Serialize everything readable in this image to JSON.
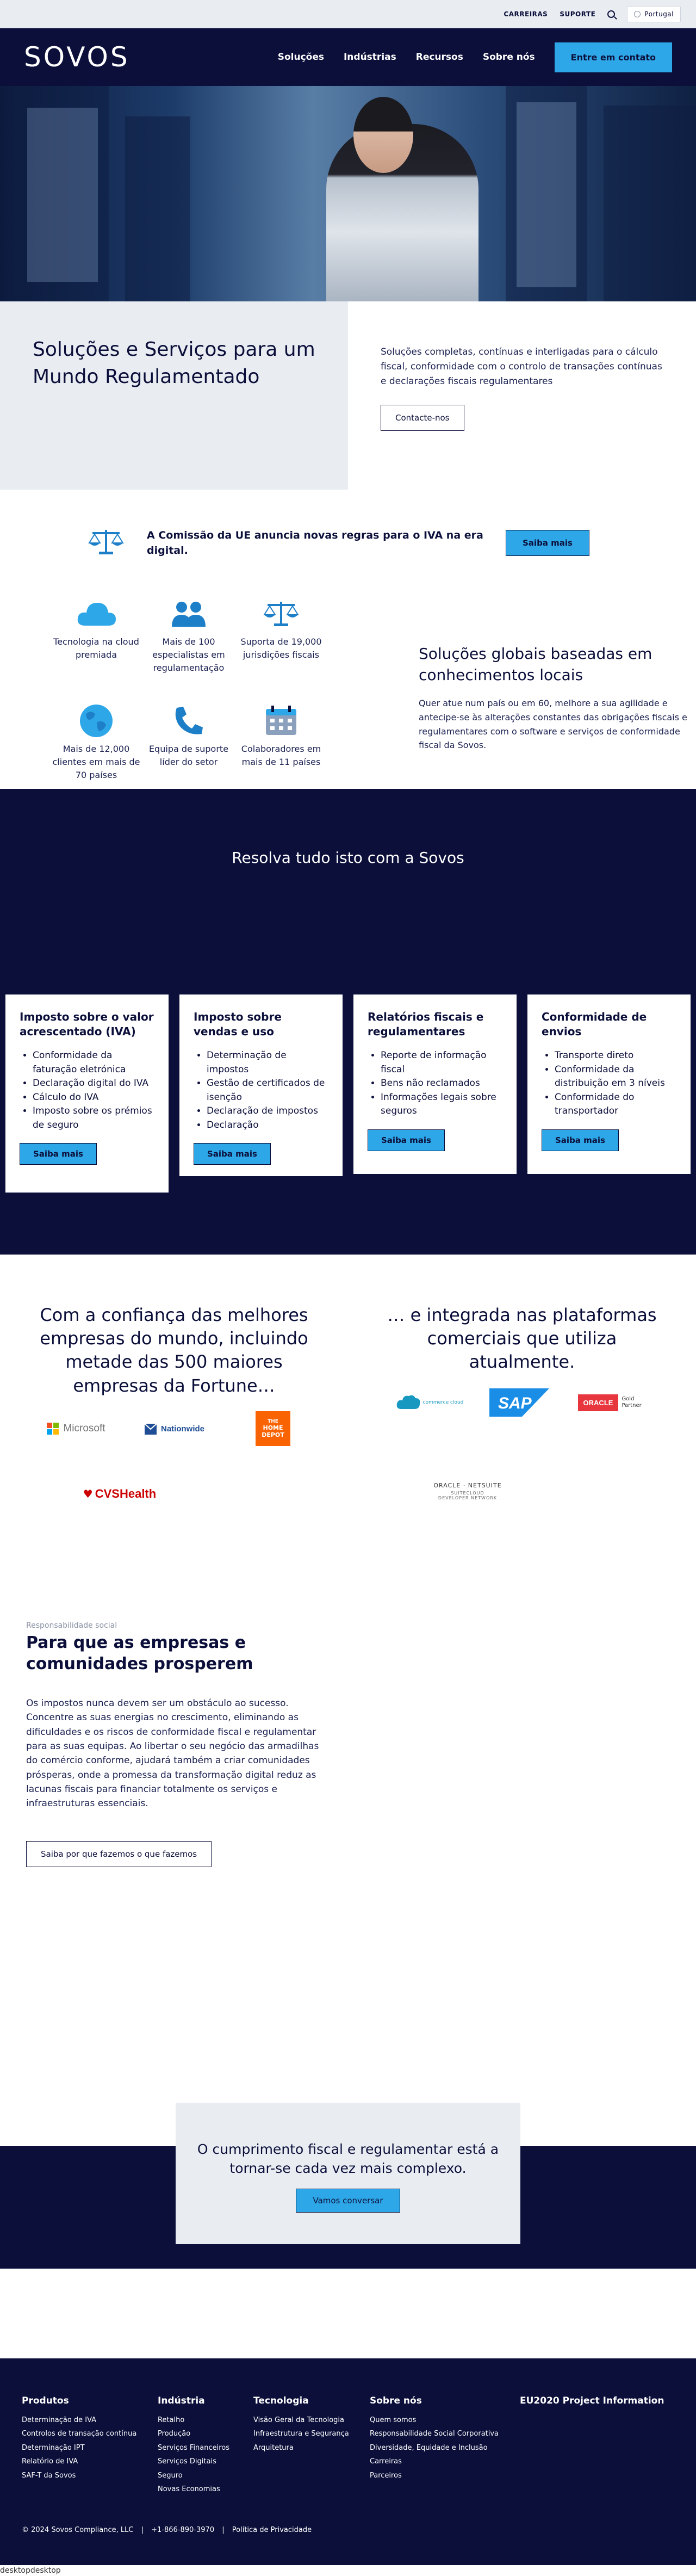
{
  "utility": {
    "careers": "CARREIRAS",
    "support": "SUPORTE",
    "language": "Portugal"
  },
  "header": {
    "logo": "SOVOS",
    "nav": [
      "Soluções",
      "Indústrias",
      "Recursos",
      "Sobre nós"
    ],
    "cta": "Entre em contato"
  },
  "intro": {
    "title": "Soluções e Serviços para um Mundo Regulamentado",
    "text": "Soluções completas, contínuas e interligadas para o cálculo fiscal, conformidade com o controlo de transações contínuas e declarações fiscais regulamentares",
    "button": "Contacte-nos"
  },
  "announcement": {
    "text": "A Comissão da UE anuncia novas regras para o IVA na era digital.",
    "button": "Saiba mais"
  },
  "features": {
    "items": [
      {
        "label": "Tecnologia na cloud premiada",
        "icon": "cloud-icon"
      },
      {
        "label": "Mais de 100 especialistas em regulamentação",
        "icon": "people-icon"
      },
      {
        "label": "Suporta de 19,000 jurisdições fiscais",
        "icon": "scales-icon"
      },
      {
        "label": "Mais de 12,000 clientes em mais de 70 países",
        "icon": "globe-icon"
      },
      {
        "label": "Equipa de suporte líder do setor",
        "icon": "phone-icon"
      },
      {
        "label": "Colaboradores em mais de 11 países",
        "icon": "calendar-icon"
      }
    ],
    "title": "Soluções globais baseadas em conhecimentos locais",
    "text": "Quer atue num país ou em 60, melhore a sua agilidade e antecipe-se às alterações constantes das obrigações fiscais e regulamentares com o software e serviços de conformidade fiscal da Sovos."
  },
  "solutions": {
    "title": "Resolva tudo isto com a Sovos",
    "cards": [
      {
        "title": "Imposto sobre o valor acrescentado (IVA)",
        "items": [
          "Conformidade da faturação eletrónica",
          "Declaração digital do IVA",
          "Cálculo do IVA",
          "Imposto sobre os prémios de seguro"
        ],
        "button": "Saiba mais"
      },
      {
        "title": "Imposto sobre vendas e uso",
        "items": [
          "Determinação de impostos",
          "Gestão de certificados de isenção",
          "Declaração de impostos",
          "Declaração"
        ],
        "button": "Saiba mais"
      },
      {
        "title": "Relatórios fiscais e regulamentares",
        "items": [
          "Reporte de informação fiscal",
          "Bens não reclamados",
          "Informações legais sobre seguros"
        ],
        "button": "Saiba mais"
      },
      {
        "title": "Conformidade de envios",
        "items": [
          "Transporte direto",
          "Conformidade da distribuição em 3 níveis",
          "Conformidade do transportador"
        ],
        "button": "Saiba mais"
      }
    ]
  },
  "trust": {
    "left_title": "Com a confiança das melhores empresas do mundo, incluindo metade das 500 maiores empresas da Fortune…",
    "right_title": "… e integrada nas plataformas comerciais que utiliza atualmente.",
    "logos": {
      "microsoft": "Microsoft",
      "nationwide": "Nationwide",
      "homedepot_1": "THE",
      "homedepot_2": "HOME",
      "homedepot_3": "DEPOT",
      "cvs": "CVSHealth",
      "salesforce": "salesforce",
      "salesforce_sub": "commerce cloud",
      "sap": "SAP",
      "oracle": "ORACLE",
      "oracle_sub": "Gold Partner",
      "netsuite": "ORACLE · NETSUITE",
      "netsuite_sub1": "SUITECLOUD",
      "netsuite_sub2": "DEVELOPER NETWORK"
    },
    "colors": {
      "microsoft": [
        "#f25022",
        "#7fba00",
        "#00a4ef",
        "#ffb900"
      ],
      "homedepot": "#f96302",
      "cvs": "#cc0000",
      "sap": "#1a8ee6",
      "oracle": "#e8363f"
    }
  },
  "social": {
    "kicker": "Responsabilidade social",
    "title": "Para que as empresas e comunidades prosperem",
    "text": "Os impostos nunca devem ser um obstáculo ao sucesso. Concentre as suas energias no crescimento, eliminando as dificuldades e os riscos de conformidade fiscal e regulamentar para as suas equipas. Ao libertar o seu negócio das armadilhas do comércio conforme, ajudará também a criar comunidades prósperas, onde a promessa da transformação digital reduz as lacunas fiscais para financiar totalmente os serviços e infraestruturas essenciais.",
    "button": "Saiba por que fazemos o que fazemos"
  },
  "compliance": {
    "title": "O cumprimento fiscal e regulamentar está a tornar-se cada vez mais complexo.",
    "button": "Vamos conversar"
  },
  "footer": {
    "columns": [
      {
        "title": "Produtos",
        "links": [
          "Determinação de IVA",
          "Controlos de transação contínua",
          "Determinação IPT",
          "Relatório de IVA",
          "SAF-T da Sovos"
        ]
      },
      {
        "title": "Indústria",
        "links": [
          "Retalho",
          "Produção",
          "Serviços Financeiros",
          "Serviços Digitais",
          "Seguro",
          "Novas Economias"
        ]
      },
      {
        "title": "Tecnologia",
        "links": [
          "Visão Geral da Tecnologia",
          "Infraestrutura e Segurança",
          "Arquitetura"
        ]
      },
      {
        "title": "Sobre nós",
        "links": [
          "Quem somos",
          "Responsabilidade Social Corporativa",
          "Diversidade, Equidade e Inclusão",
          "Carreiras",
          "Parceiros"
        ]
      },
      {
        "title": "EU2020 Project Information",
        "links": []
      }
    ],
    "copyright": "© 2024 Sovos Compliance, LLC",
    "phone": "+1-866-890-3970",
    "privacy": "Política de Privacidade"
  },
  "device_label": "desktopdesktop",
  "colors": {
    "navy": "#0b0f3a",
    "accent": "#2ea7e8",
    "light": "#e9edf2"
  }
}
